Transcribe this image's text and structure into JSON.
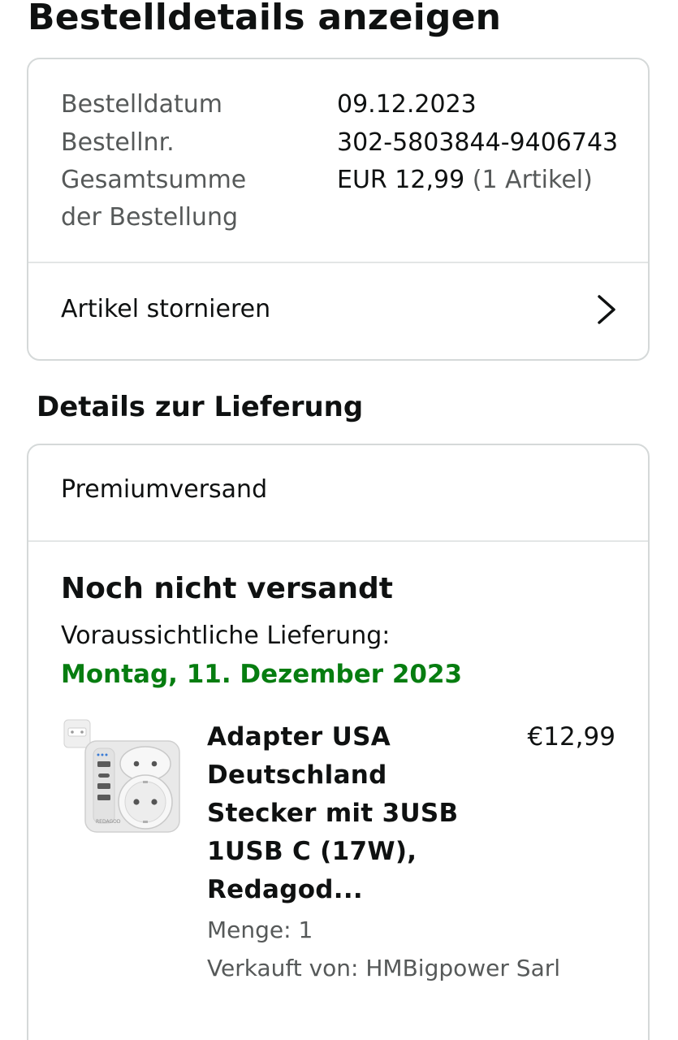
{
  "page_title": "Bestelldetails anzeigen",
  "summary": {
    "rows": [
      {
        "label": "Bestelldatum",
        "value": "09.12.2023"
      },
      {
        "label": "Bestellnr.",
        "value": "302-5803844-9406743"
      },
      {
        "label": "Gesamtsumme",
        "value": "EUR 12,99",
        "value_extra": "(1 Artikel)"
      },
      {
        "label": "der Bestellung"
      }
    ],
    "cancel_label": "Artikel stornieren"
  },
  "delivery": {
    "section_title": "Details zur Lieferung",
    "shipping_method": "Premiumversand",
    "status": "Noch nicht versandt",
    "eta_label": "Voraussichtliche Lieferung:",
    "eta_date": "Montag, 11. Dezember 2023",
    "eta_color": "#067d10"
  },
  "product": {
    "title_lines": [
      "Adapter USA",
      "Deutschland",
      "Stecker mit 3USB",
      "1USB C (17W),",
      "Redagod..."
    ],
    "price": "€12,99",
    "quantity": "Menge: 1",
    "seller": "Verkauft von: HMBigpower Sarl",
    "image_icon": "power-adapter-image",
    "image_brand": "REDAGOD"
  },
  "colors": {
    "border": "#d5d9d9",
    "muted_text": "#565959",
    "text": "#0f1111"
  }
}
